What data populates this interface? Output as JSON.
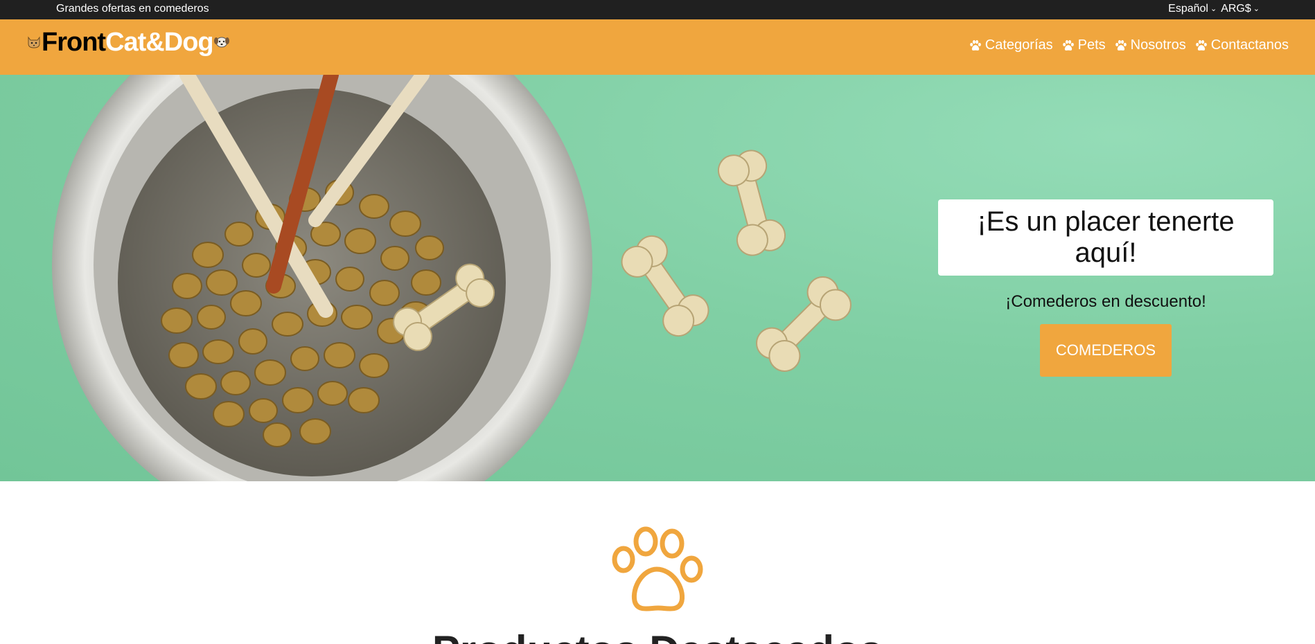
{
  "topbar": {
    "promo": "Grandes ofertas en comederos",
    "language": "Español",
    "currency": "ARG$"
  },
  "brand": {
    "part1": "Front",
    "part2": "Cat&Dog",
    "left_icon": "cat-face-icon",
    "right_icon": "dog-face-icon"
  },
  "nav": {
    "items": [
      {
        "label": "Categorías",
        "icon": "paw-icon"
      },
      {
        "label": "Pets",
        "icon": "paw-icon"
      },
      {
        "label": "Nosotros",
        "icon": "paw-icon"
      },
      {
        "label": "Contactanos",
        "icon": "paw-icon"
      }
    ]
  },
  "hero": {
    "title": "¡Es un placer tenerte aquí!",
    "subtitle": "¡Comederos en descuento!",
    "button": "COMEDEROS"
  },
  "section": {
    "title": "Productos Destacados",
    "icon": "paw-outline-icon"
  },
  "colors": {
    "accent": "#f0a63e",
    "topbar": "#202020",
    "hero_bg": "#7fcfa3"
  }
}
